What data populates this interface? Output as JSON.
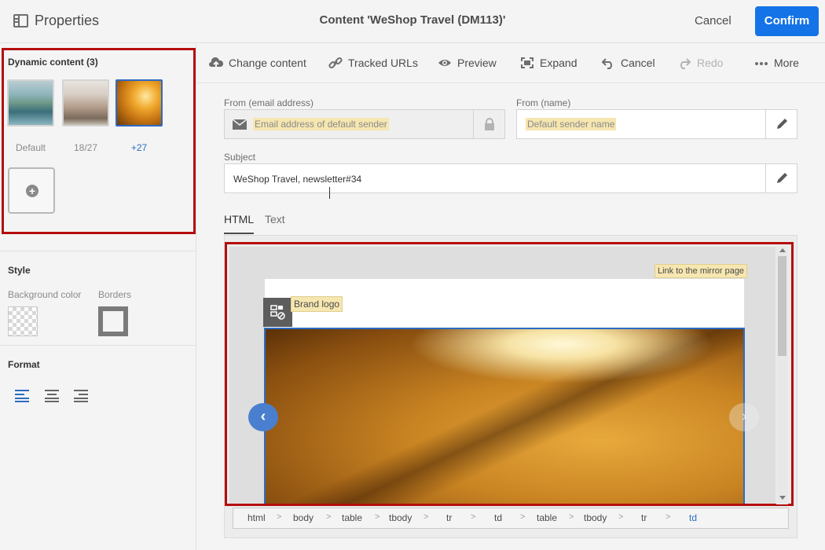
{
  "header": {
    "panel_title": "Properties",
    "content_title": "Content 'WeShop Travel (DM113)'",
    "cancel_label": "Cancel",
    "confirm_label": "Confirm"
  },
  "left_panel": {
    "dynamic_title": "Dynamic content (3)",
    "thumbs": [
      {
        "label": "Default"
      },
      {
        "label": "18/27"
      },
      {
        "label": "+27"
      }
    ],
    "add_symbol": "+",
    "style_title": "Style",
    "bg_color_label": "Background color",
    "borders_label": "Borders",
    "format_title": "Format"
  },
  "toolbar": {
    "change_content": "Change content",
    "tracked_urls": "Tracked URLs",
    "preview": "Preview",
    "expand": "Expand",
    "cancel": "Cancel",
    "redo": "Redo",
    "more": "More"
  },
  "form": {
    "from_email_label": "From (email address)",
    "from_email_placeholder": "Email address of default sender",
    "from_name_label": "From (name)",
    "from_name_placeholder": "Default sender name",
    "subject_label": "Subject",
    "subject_value": "WeShop Travel, newsletter#34"
  },
  "tabs": [
    {
      "label": "HTML",
      "active": true
    },
    {
      "label": "Text",
      "active": false
    }
  ],
  "editor": {
    "mirror_link": "Link to the mirror page",
    "brand_logo": "Brand logo",
    "nav_prev": "‹",
    "nav_next": "›"
  },
  "breadcrumb": [
    "html",
    "body",
    "table",
    "tbody",
    "tr",
    "td",
    "table",
    "tbody",
    "tr",
    "td"
  ],
  "colors": {
    "accent": "#1473e6",
    "highlight_border": "#b50d0d",
    "selection_blue": "#2b6cc4"
  }
}
